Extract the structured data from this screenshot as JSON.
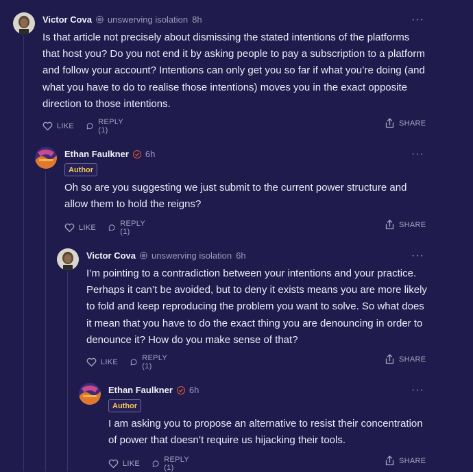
{
  "comments": [
    {
      "name": "Victor Cova",
      "handle": "unswerving isolation",
      "time": "8h",
      "text": "Is that article not precisely about dismissing the stated intentions of the platforms that host you? Do you not end it by asking people to pay a subscription to a platform and follow your account? Intentions can only get you so far if what you’re doing (and what you have to do to realise those intentions) moves you in the exact opposite direction to those intentions.",
      "like_label": "LIKE",
      "reply_label": "REPLY (1)",
      "share_label": "SHARE",
      "more_label": "···"
    },
    {
      "name": "Ethan Faulkner",
      "time": "6h",
      "badge": "Author",
      "text": "Oh so are you suggesting we just submit to the current power structure and allow them to hold the reigns?",
      "like_label": "LIKE",
      "reply_label": "REPLY (1)",
      "share_label": "SHARE",
      "more_label": "···"
    },
    {
      "name": "Victor Cova",
      "handle": "unswerving isolation",
      "time": "6h",
      "text": "I’m pointing to a contradiction between your intentions and your practice. Perhaps it can’t be avoided, but to deny it exists means you are more likely to fold and keep reproducing the problem you want to solve. So what does it mean that you have to do the exact thing you are denouncing in order to denounce it? How do you make sense of that?",
      "like_label": "LIKE",
      "reply_label": "REPLY (1)",
      "share_label": "SHARE",
      "more_label": "···"
    },
    {
      "name": "Ethan Faulkner",
      "time": "6h",
      "badge": "Author",
      "text": "I am asking you to propose an alternative to resist their concentration of power that doesn’t require us hijacking their tools.",
      "like_label": "LIKE",
      "reply_label": "REPLY (1)",
      "share_label": "SHARE",
      "more_label": "···"
    }
  ],
  "colors": {
    "background": "#1f1b4d",
    "thread_line": "#3a356a",
    "author_badge_text": "#f2c94c",
    "verified_badge": "#e65a33"
  },
  "icons": [
    "subscriber-icon",
    "verified-icon",
    "heart-icon",
    "comment-bubble-icon",
    "share-icon",
    "more-dots-icon"
  ]
}
